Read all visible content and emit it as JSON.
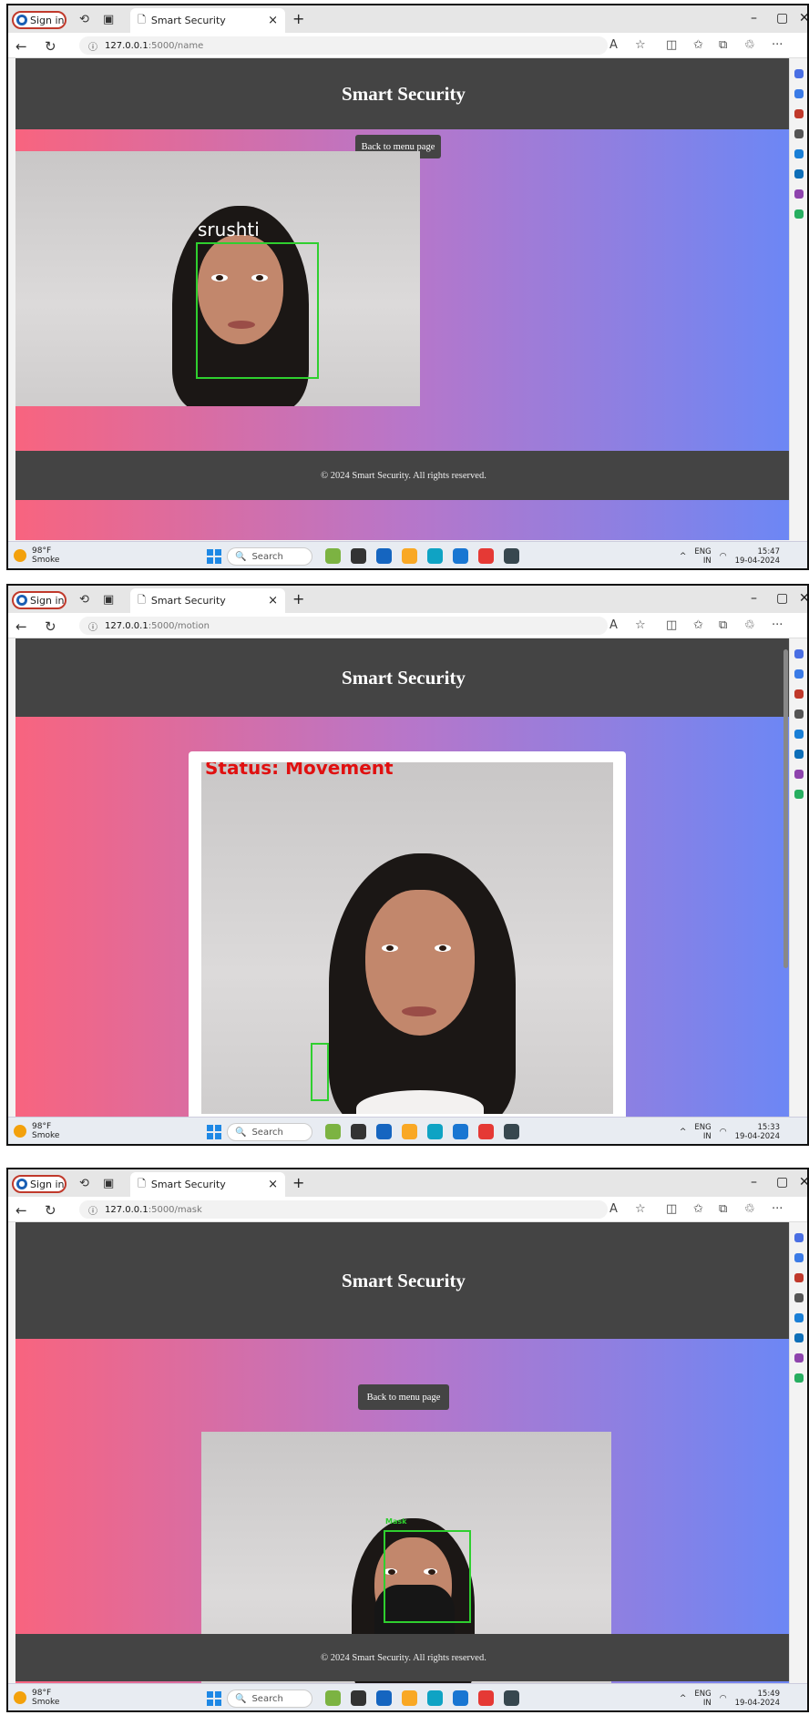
{
  "screens": [
    {
      "tab_title": "Smart Security",
      "url_host": "127.0.0.1",
      "url_path": ":5000/name",
      "header_title": "Smart Security",
      "back_button": "Back to menu page",
      "camera_label": "srushti",
      "footer_text": "© 2024 Smart Security. All rights reserved.",
      "time": "15:47",
      "date": "19-04-2024"
    },
    {
      "tab_title": "Smart Security",
      "url_host": "127.0.0.1",
      "url_path": ":5000/motion",
      "header_title": "Smart Security",
      "camera_label": "Status: Movement",
      "time": "15:33",
      "date": "19-04-2024"
    },
    {
      "tab_title": "Smart Security",
      "url_host": "127.0.0.1",
      "url_path": ":5000/mask",
      "header_title": "Smart Security",
      "back_button": "Back to menu page",
      "camera_label": "Mask",
      "footer_text": "© 2024 Smart Security. All rights reserved.",
      "time": "15:49",
      "date": "19-04-2024"
    }
  ],
  "browser": {
    "signin_label": "Sign in",
    "new_tab_symbol": "+",
    "close_symbol": "×"
  },
  "taskbar": {
    "weather_temp": "98°F",
    "weather_desc": "Smoke",
    "search_label": "Search",
    "lang_top": "ENG",
    "lang_bottom": "IN"
  },
  "colors": {
    "gradient_left": "#f8647f",
    "gradient_right": "#6c87f5",
    "header_bg": "#444444",
    "detection_box": "#2fcf2f",
    "status_text": "#e01010"
  },
  "icons": [
    "profile-icon",
    "workspaces-icon",
    "tab-actions-icon",
    "page-icon",
    "back-arrow-icon",
    "refresh-icon",
    "info-icon",
    "read-aloud-icon",
    "favorite-star-icon",
    "split-screen-icon",
    "favorites-icon",
    "collections-icon",
    "extensions-icon",
    "more-icon",
    "windows-logo-icon",
    "search-icon"
  ]
}
